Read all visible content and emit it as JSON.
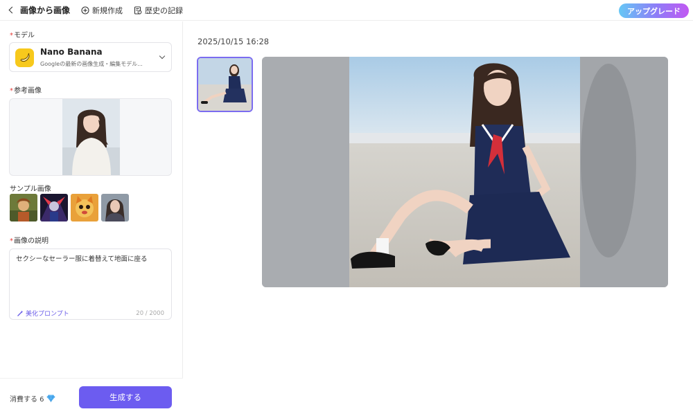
{
  "topbar": {
    "back_label": "画像から画像",
    "new_label": "新規作成",
    "history_label": "歴史の記録",
    "upgrade_label": "アップグレード"
  },
  "model": {
    "label": "モデル",
    "name": "Nano Banana",
    "description": "Googleの最新の画像生成・編集モデル..."
  },
  "reference": {
    "label": "参考画像"
  },
  "samples": {
    "label": "サンプル画像"
  },
  "description": {
    "label": "画像の説明",
    "value": "セクシーなセーラー服に着替えて地面に座る",
    "beautify_label": "美化プロンプト",
    "counter": "20 / 2000"
  },
  "footer": {
    "consume_label": "消費する 6",
    "generate_label": "生成する"
  },
  "result": {
    "timestamp": "2025/10/15 16:28"
  },
  "icons": {
    "back": "chevron-left-icon",
    "new": "plus-circle-icon",
    "history": "history-icon",
    "model": "banana-icon",
    "select": "chevron-down-icon",
    "beautify": "magic-wand-icon",
    "credits": "diamond-icon"
  },
  "colors": {
    "accent": "#6c5cf0",
    "required": "#e53935",
    "model_icon_bg": "#f7c91c"
  }
}
